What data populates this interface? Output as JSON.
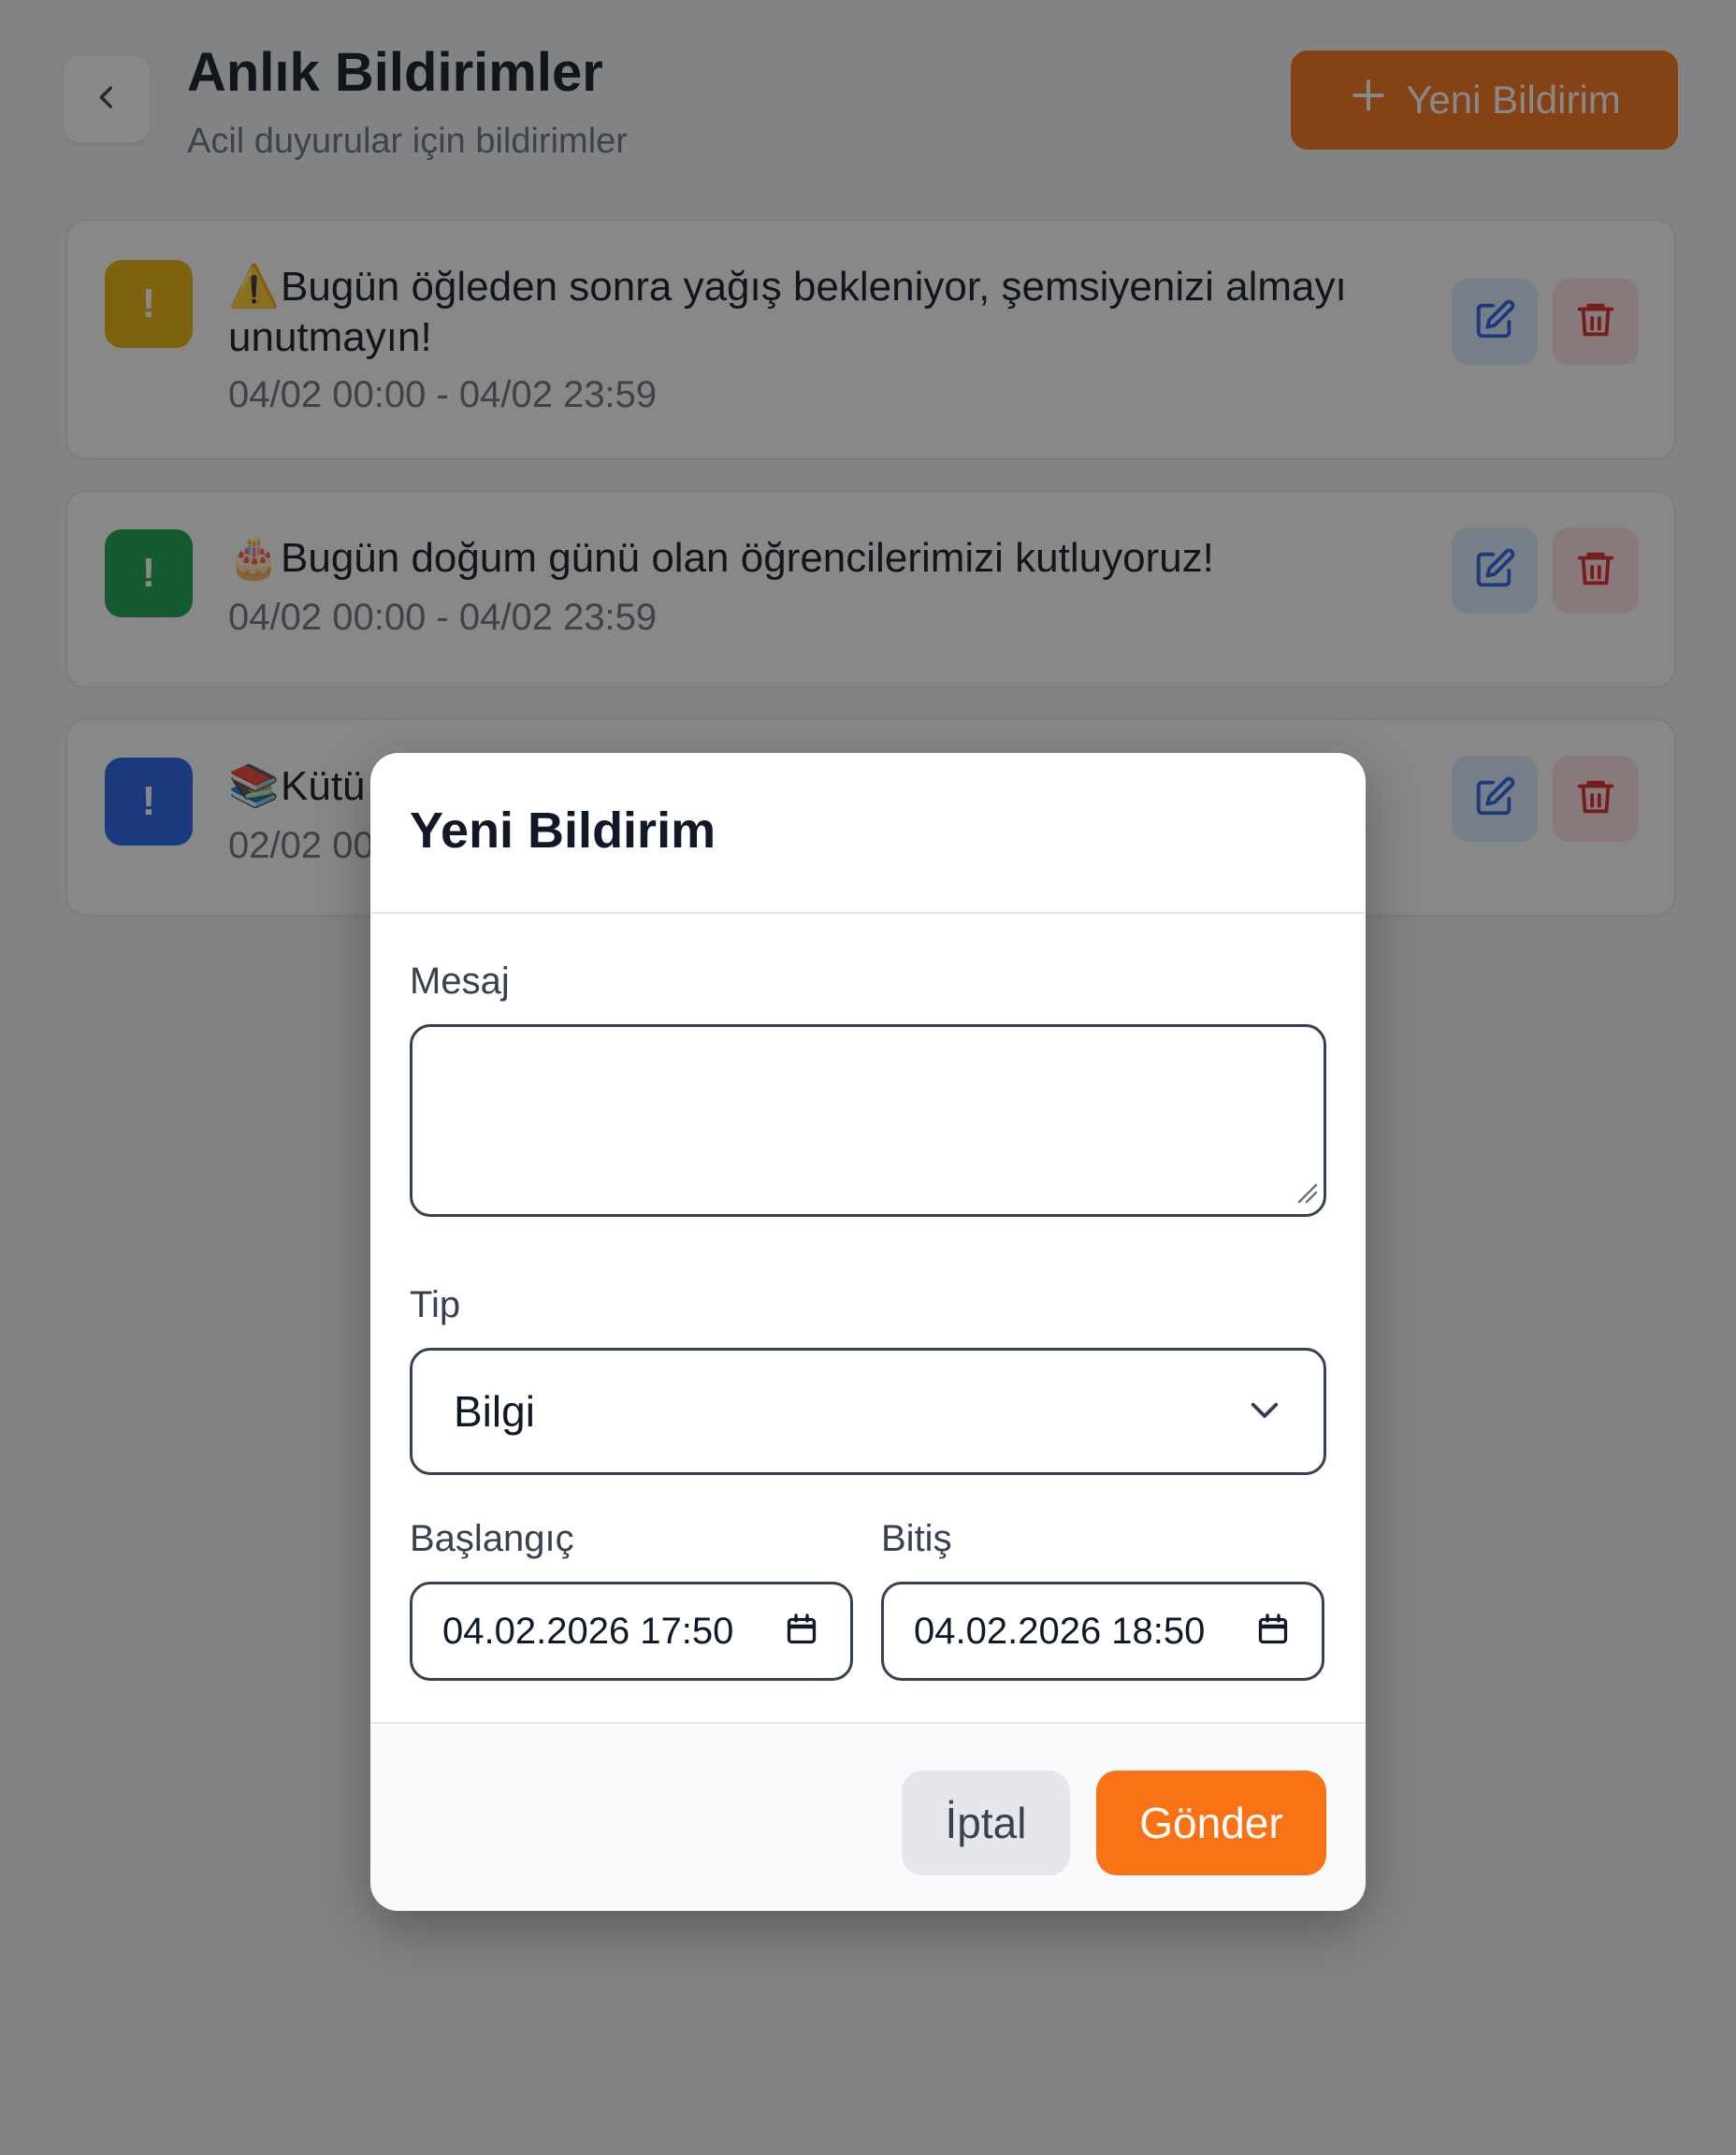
{
  "header": {
    "title": "Anlık Bildirimler",
    "subtitle": "Acil duyurular için bildirimler",
    "new_button_label": "Yeni Bildirim"
  },
  "notifications": [
    {
      "badge": "!",
      "color": "#eab308",
      "emoji": "⚠️",
      "message": "Bugün öğleden sonra yağış bekleniyor, şemsiyenizi almayı unutmayın!",
      "date_range": "04/02 00:00 - 04/02 23:59"
    },
    {
      "badge": "!",
      "color": "#16a34a",
      "emoji": "🎂",
      "message": "Bugün doğum günü olan öğrencilerimizi kutluyoruz!",
      "date_range": "04/02 00:00 - 04/02 23:59"
    },
    {
      "badge": "!",
      "color": "#2563eb",
      "emoji": "📚",
      "message": "Kütü",
      "date_range": "02/02 00"
    }
  ],
  "modal": {
    "title": "Yeni Bildirim",
    "message_label": "Mesaj",
    "message_value": "",
    "type_label": "Tip",
    "type_value": "Bilgi",
    "start_label": "Başlangıç",
    "start_value": "04.02.2026 17:50",
    "end_label": "Bitiş",
    "end_value": "04.02.2026 18:50",
    "cancel_label": "İptal",
    "submit_label": "Gönder"
  },
  "colors": {
    "accent": "#f97316",
    "edit": "#2563eb",
    "delete": "#dc2626"
  }
}
